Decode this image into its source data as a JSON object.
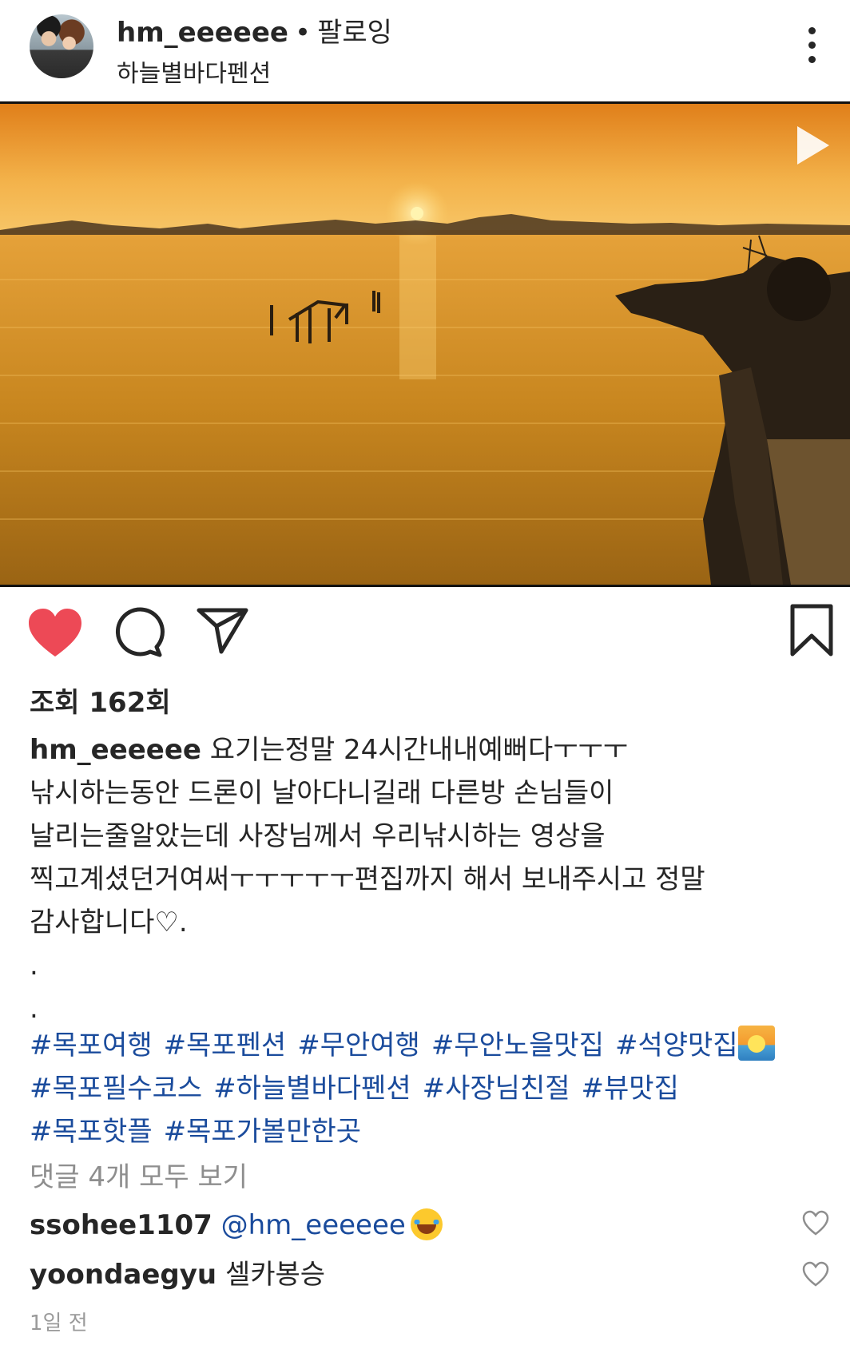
{
  "header": {
    "username": "hm_eeeeee",
    "separator": "•",
    "follow_status": "팔로잉",
    "location": "하늘별바다펜션",
    "more_icon": "vertical-ellipsis-icon"
  },
  "media": {
    "type": "video",
    "play_icon": "play-icon",
    "colors": {
      "sky_top": "#e8901f",
      "sky_low": "#f7c25a",
      "water": "#c98a1e",
      "shore": "#2a2015"
    }
  },
  "actions": {
    "like_icon": "heart-filled-icon",
    "like_color": "#ed4956",
    "comment_icon": "comment-icon",
    "share_icon": "paper-plane-icon",
    "save_icon": "bookmark-icon"
  },
  "views": {
    "text": "조회 162회"
  },
  "caption": {
    "username": "hm_eeeeee",
    "text": " 요기는정말 24시간내내예뻐다ㅜㅜㅜ\n 낚시하는동안 드론이 날아다니길래 다른방 손님들이\n날리는줄알았는데 사장님께서 우리낚시하는 영상을\n찍고계셨던거여써ㅜㅜㅜㅜㅜ편집까지 해서 보내주시고 정말\n감사합니다♡.\n.\n."
  },
  "hashtags": [
    "#목포여행",
    "#목포펜션",
    "#무안여행",
    "#무안노을맛집",
    "#석양맛집",
    "#목포필수코스",
    "#하늘별바다펜션",
    "#사장님친절",
    "#뷰맛집",
    "#목포핫플",
    "#목포가볼만한곳"
  ],
  "comments_link": "댓글 4개 모두 보기",
  "comments": [
    {
      "user": "ssohee1107",
      "text": "@hm_eeeeee",
      "emoji": "laughing-tears-emoji"
    },
    {
      "user": "yoondaegyu",
      "text": "셀카봉승"
    }
  ],
  "timestamp": "1일 전"
}
